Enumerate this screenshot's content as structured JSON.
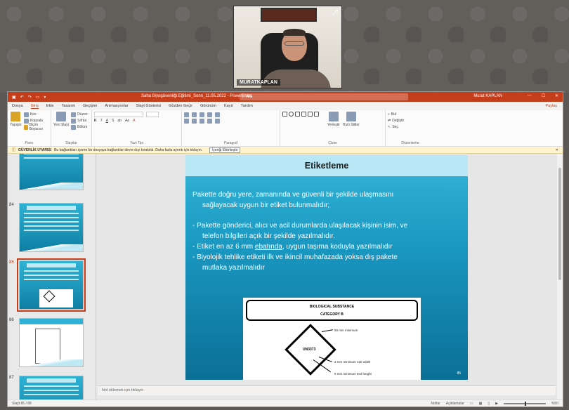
{
  "webcam": {
    "name_tag": "MURATKAPLAN",
    "expand_icon": "expand-icon"
  },
  "titlebar": {
    "doc_title": "Saha Biyogüvenliği Eğitimi_Sonn_11.05.2022 - PowerPoint",
    "search_placeholder": "Ara",
    "user": "Murat KAPLAN",
    "minimize": "—",
    "maximize": "☐",
    "close": "✕"
  },
  "ribbon_tabs": [
    "Dosya",
    "Giriş",
    "Ekle",
    "Tasarım",
    "Geçişler",
    "Animasyonlar",
    "Slayt Gösterisi",
    "Gözden Geçir",
    "Görünüm",
    "Kayıt",
    "Yardım"
  ],
  "active_tab": "Giriş",
  "share_label": "Paylaş",
  "ribbon": {
    "clipboard": {
      "paste": "Yapıştır",
      "cut": "Kes",
      "copy": "Kopyala",
      "format_painter": "Biçim Boyacısı",
      "name": "Pano"
    },
    "slides": {
      "new_slide": "Yeni Slayt",
      "layout": "Düzen",
      "reset": "Sıfırla",
      "section": "Bölüm",
      "name": "Slaytlar"
    },
    "font": {
      "name": "Yazı Tipi"
    },
    "paragraph": {
      "name": "Paragraf"
    },
    "drawing": {
      "arrange": "Yerleştir",
      "quick_styles": "Hızlı Stiller",
      "name": "Çizim"
    },
    "editing": {
      "find": "Bul",
      "replace": "Değiştir",
      "select": "Seç",
      "name": "Düzenleme"
    }
  },
  "warning": {
    "label": "GÜVENLİK UYARISI",
    "text": "Bu bağlantıları içeren bir dosyaya bağlantılar devre dışı bırakıldı. Daha fazla ayrıntı için tıklayın.",
    "button": "İçeriği Etkinleştir"
  },
  "thumbnails": [
    {
      "num": ""
    },
    {
      "num": "84"
    },
    {
      "num": "85"
    },
    {
      "num": "86"
    },
    {
      "num": "87"
    }
  ],
  "slide": {
    "title": "Etiketleme",
    "bullet1": "Pakette doğru yere, zamanında ve güvenli bir şekilde ulaşmasını",
    "bullet1b": "sağlayacak uygun bir etiket bulunmalıdır;",
    "bullet2": "- Pakette gönderici, alıcı ve acil durumlarda ulaşılacak kişinin isim, ve",
    "bullet2b": "telefon bilgileri açık bir şekilde yazılmalıdır.",
    "bullet3_pre": "- Etiket en az 6 mm ",
    "bullet3_u": "ebatında",
    "bullet3_post": ",  uygun taşıma koduyla yazılmalıdır",
    "bullet4": "- Biyolojik tehlike etiketi ilk ve ikincil muhafazada yoksa dış pakete",
    "bullet4b": "mutlaka  yazılmalıdır",
    "bio_title": "BIOLOGICAL SUBSTANCE",
    "bio_category": "CATEGORY B",
    "un_code": "UN3373",
    "ann_min": "50 mm minimum",
    "ann_line": "2 mm minimum rule width",
    "ann_text": "6 mm minimum text height",
    "slide_number": "85"
  },
  "notes_placeholder": "Not eklemek için tıklayın",
  "status": {
    "slide_info": "Slayt 85 / 88",
    "notes": "Notlar",
    "comments": "Açıklamalar",
    "zoom": "%50"
  }
}
